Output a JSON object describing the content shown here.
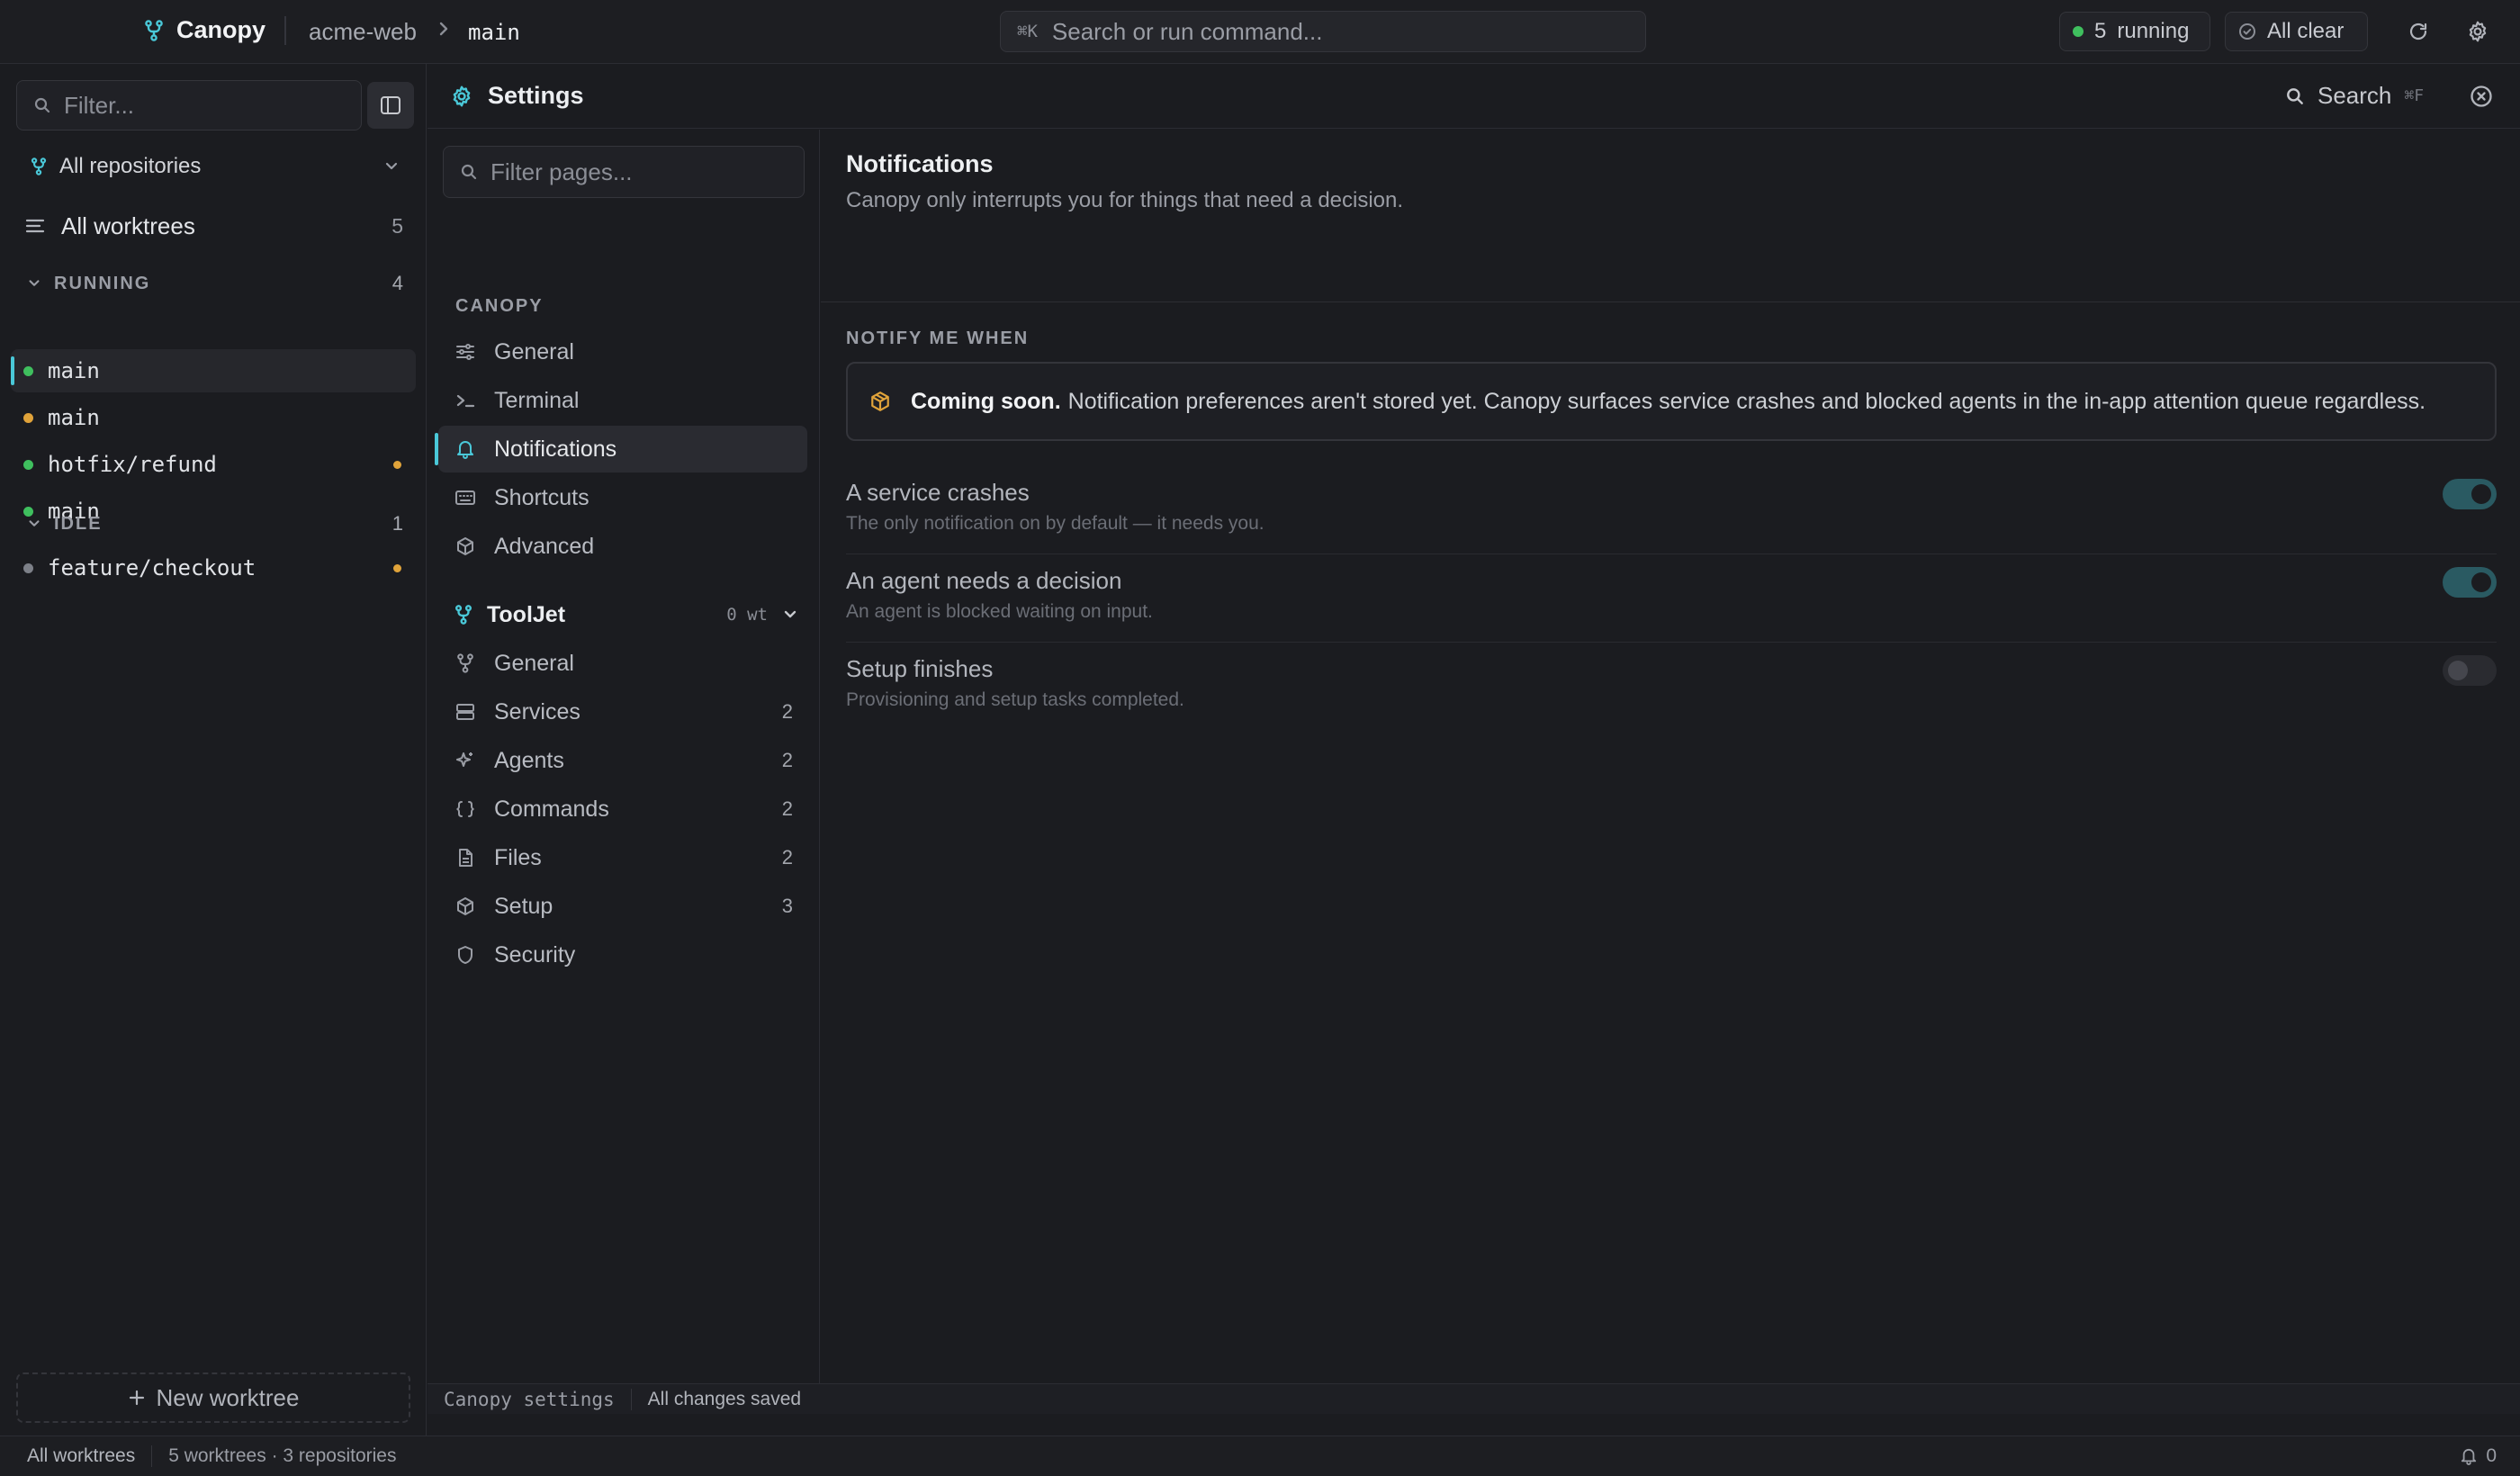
{
  "topbar": {
    "app_name": "Canopy",
    "repo": "acme-web",
    "branch": "main",
    "command_kbd": "⌘K",
    "command_placeholder": "Search or run command...",
    "running_count": "5",
    "running_label": "running",
    "status_label": "All clear"
  },
  "sidebar": {
    "filter_placeholder": "Filter...",
    "repo_selector": "All repositories",
    "all_worktrees_label": "All worktrees",
    "all_worktrees_count": "5",
    "groups": [
      {
        "label": "RUNNING",
        "count": "4",
        "items": [
          {
            "name": "main",
            "status": "running",
            "modified": false,
            "active": true
          },
          {
            "name": "main",
            "status": "warning",
            "modified": false,
            "active": false
          },
          {
            "name": "hotfix/refund",
            "status": "running",
            "modified": true,
            "active": false
          },
          {
            "name": "main",
            "status": "running",
            "modified": false,
            "active": false
          }
        ]
      },
      {
        "label": "IDLE",
        "count": "1",
        "items": [
          {
            "name": "feature/checkout",
            "status": "idle",
            "modified": true,
            "active": false
          }
        ]
      }
    ],
    "new_worktree_label": "New worktree"
  },
  "settings": {
    "title": "Settings",
    "search_label": "Search",
    "search_kbd": "⌘F",
    "nav_filter_placeholder": "Filter pages...",
    "canopy_section": "CANOPY",
    "canopy_items": [
      {
        "label": "General",
        "icon": "sliders-icon"
      },
      {
        "label": "Terminal",
        "icon": "terminal-icon"
      },
      {
        "label": "Notifications",
        "icon": "bell-icon",
        "active": true
      },
      {
        "label": "Shortcuts",
        "icon": "keyboard-icon"
      },
      {
        "label": "Advanced",
        "icon": "cube-icon"
      }
    ],
    "project": {
      "name": "ToolJet",
      "worktree_count": "0 wt"
    },
    "project_items": [
      {
        "label": "General",
        "icon": "branch-icon",
        "count": ""
      },
      {
        "label": "Services",
        "icon": "server-icon",
        "count": "2"
      },
      {
        "label": "Agents",
        "icon": "sparkle-icon",
        "count": "2"
      },
      {
        "label": "Commands",
        "icon": "braces-icon",
        "count": "2"
      },
      {
        "label": "Files",
        "icon": "file-icon",
        "count": "2"
      },
      {
        "label": "Setup",
        "icon": "cube-icon",
        "count": "3"
      },
      {
        "label": "Security",
        "icon": "shield-icon",
        "count": ""
      }
    ],
    "page": {
      "title": "Notifications",
      "subtitle": "Canopy only interrupts you for things that need a decision.",
      "section_heading": "NOTIFY ME WHEN",
      "banner_strong": "Coming soon.",
      "banner_text": "Notification preferences aren't stored yet. Canopy surfaces service crashes and blocked agents in the in-app attention queue regardless.",
      "options": [
        {
          "title": "A service crashes",
          "description": "The only notification on by default — it needs you.",
          "enabled": true
        },
        {
          "title": "An agent needs a decision",
          "description": "An agent is blocked waiting on input.",
          "enabled": true
        },
        {
          "title": "Setup finishes",
          "description": "Provisioning and setup tasks completed.",
          "enabled": false
        }
      ]
    },
    "status_left": "Canopy settings",
    "status_right": "All changes saved"
  },
  "footer": {
    "scope": "All worktrees",
    "summary": "5 worktrees · 3 repositories",
    "notification_count": "0"
  },
  "colors": {
    "accent": "#4ac8d8",
    "running": "#3fbf5e",
    "warning": "#e0a33a",
    "idle": "#7d8088"
  }
}
